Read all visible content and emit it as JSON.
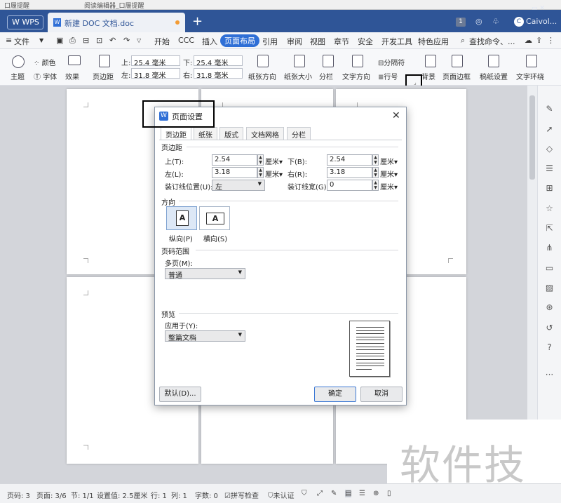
{
  "top_strip": {
    "left": "口履提醒",
    "middle": "阅读编辑器_口履提醒"
  },
  "tabs": {
    "wps_label": "WPS",
    "doc_label": "新建 DOC 文档.doc",
    "new_tab": "+"
  },
  "titlebar": {
    "badge": "1",
    "user": "Caivol...",
    "more": "⋮"
  },
  "menu": {
    "file": "文件",
    "items": [
      "开始",
      "CCC",
      "插入",
      "页面布局",
      "引用",
      "审阅",
      "视图",
      "章节",
      "安全",
      "开发工具",
      "特色应用"
    ],
    "active": "页面布局",
    "search": "查找命令、...",
    "more": "..."
  },
  "ribbon": {
    "theme": "主题",
    "color": "颜色",
    "font": "字体",
    "effect": "效果",
    "margins": "页边距",
    "top_label": "上:",
    "top_value": "25.4 毫米",
    "bottom_label": "下:",
    "bottom_value": "25.4 毫米",
    "left_label": "左:",
    "left_value": "31.8 毫米",
    "right_label": "右:",
    "right_value": "31.8 毫米",
    "orientation": "纸张方向",
    "size": "纸张大小",
    "columns": "分栏",
    "text_direction": "文字方向",
    "breaks": "分隔符",
    "line_numbers": "行号",
    "background": "背景",
    "page_border": "页面边框",
    "manuscript": "稿纸设置",
    "text_wrap": "文字环绕"
  },
  "dialog": {
    "title": "页面设置",
    "close": "✕",
    "tabs": [
      "页边距",
      "纸张",
      "版式",
      "文档网格",
      "分栏"
    ],
    "margins_section": "页边距",
    "top_label": "上(T):",
    "top_value": "2.54",
    "bottom_label": "下(B):",
    "bottom_value": "2.54",
    "left_label": "左(L):",
    "left_value": "3.18",
    "right_label": "右(R):",
    "right_value": "3.18",
    "unit": "厘米",
    "gutter_pos_label": "装订线位置(U):",
    "gutter_pos_value": "左",
    "gutter_width_label": "装订线宽(G):",
    "gutter_width_value": "0",
    "orientation_section": "方向",
    "portrait": "纵向(P)",
    "landscape": "横向(S)",
    "page_glyph": "A",
    "pages_section": "页码范围",
    "multi_label": "多页(M):",
    "multi_value": "普通",
    "preview_section": "预览",
    "apply_label": "应用于(Y):",
    "apply_value": "整篇文档",
    "default_button": "默认(D)...",
    "ok_button": "确定",
    "cancel_button": "取消"
  },
  "status": {
    "page": "页码: 3",
    "pages": "页面: 3/6",
    "section": "节: 1/1",
    "setting": "设置值: 2.5厘米",
    "row": "行: 1",
    "col": "列: 1",
    "words": "字数: 0",
    "spell": "拼写检查",
    "cert": "未认证"
  },
  "watermark": "软件技巧"
}
